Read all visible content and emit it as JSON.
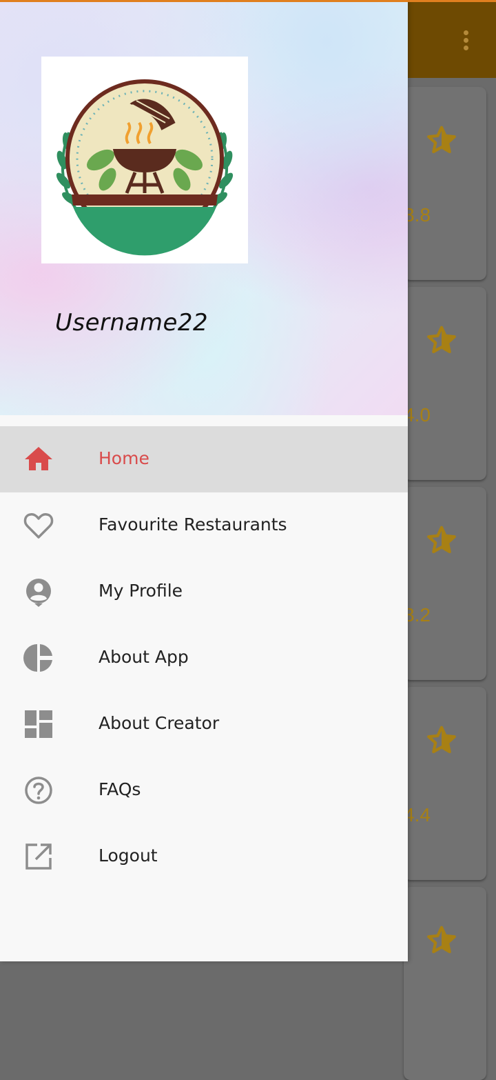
{
  "theme": {
    "accent": "#d94b4b",
    "toolbar": "#6e4a02",
    "rating_color": "#a88014",
    "icon_color": "#8d8d8d"
  },
  "drawer": {
    "username": "Username22",
    "logo_icon": "barbecue-grill-logo",
    "menu": [
      {
        "label": "Home",
        "icon": "home-icon",
        "active": true
      },
      {
        "label": "Favourite Restaurants",
        "icon": "heart-icon",
        "active": false
      },
      {
        "label": "My Profile",
        "icon": "account-circle-icon",
        "active": false
      },
      {
        "label": "About App",
        "icon": "pie-chart-icon",
        "active": false
      },
      {
        "label": "About Creator",
        "icon": "dashboard-icon",
        "active": false
      },
      {
        "label": "FAQs",
        "icon": "help-circle-icon",
        "active": false
      },
      {
        "label": "Logout",
        "icon": "open-external-icon",
        "active": false
      }
    ]
  },
  "background_list": {
    "ratings": [
      "3.8",
      "4.0",
      "3.2",
      "4.4",
      ""
    ]
  }
}
